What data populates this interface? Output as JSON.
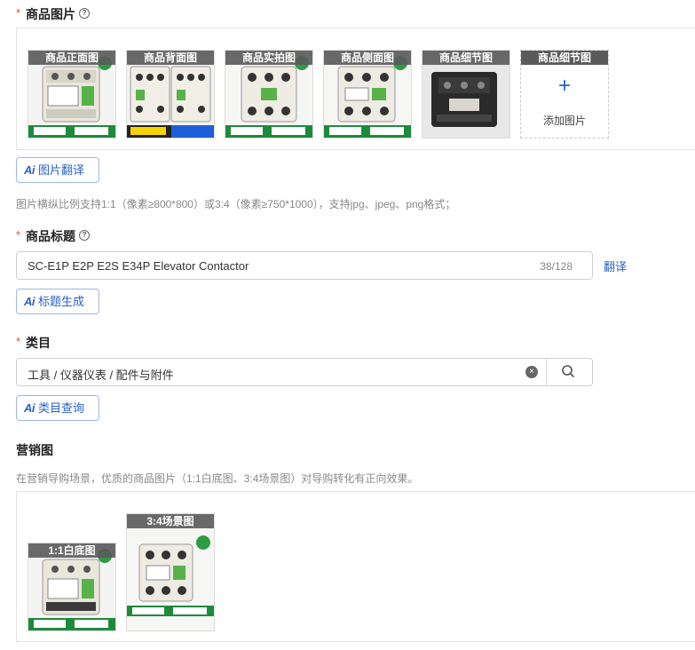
{
  "images_section": {
    "label": "商品图片",
    "required_mark": "*",
    "help_icon": "question-circle-icon",
    "thumbnails": [
      {
        "caption": "商品正面图"
      },
      {
        "caption": "商品背面图"
      },
      {
        "caption": "商品实拍图"
      },
      {
        "caption": "商品侧面图"
      },
      {
        "caption": "商品细节图"
      }
    ],
    "add_slot": {
      "caption": "商品细节图",
      "plus": "+",
      "label": "添加图片"
    },
    "ai_button": {
      "badge": "Ai",
      "label": "图片翻译"
    },
    "hint": "图片横纵比例支持1:1（像素≥800*800）或3:4（像素≥750*1000），支持jpg、jpeg、png格式；"
  },
  "title_section": {
    "label": "商品标题",
    "required_mark": "*",
    "value": "SC-E1P E2P E2S E34P Elevator Contactor",
    "counter": "38/128",
    "translate_link": "翻译",
    "ai_button": {
      "badge": "Ai",
      "label": "标题生成"
    }
  },
  "category_section": {
    "label": "类目",
    "required_mark": "*",
    "value": "工具 / 仪器仪表 / 配件与附件",
    "ai_button": {
      "badge": "Ai",
      "label": "类目查询"
    }
  },
  "marketing_section": {
    "label": "营销图",
    "hint": "在营销导购场景，优质的商品图片（1:1白底图、3:4场景图）对导购转化有正向效果。",
    "images": [
      {
        "caption": "1:1白底图"
      },
      {
        "caption": "3:4场景图"
      }
    ]
  },
  "colors": {
    "accent": "#2a62c9",
    "required": "#e5484d",
    "banner_green": "#1e8a3c"
  }
}
